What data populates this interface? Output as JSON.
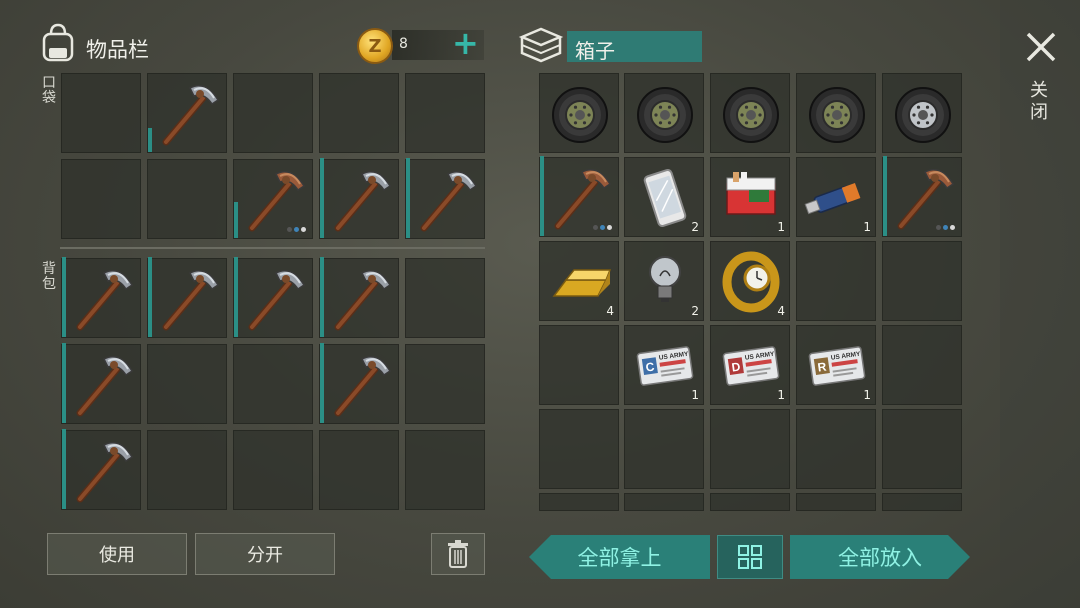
{
  "inventory": {
    "title": "物品栏",
    "pocket_label": "口袋",
    "backpack_label": "背包",
    "coins": "8",
    "coin_symbol": "Z",
    "add_coins_symbol": "+",
    "pocket_slots": [
      {
        "item": "empty"
      },
      {
        "item": "pickaxe",
        "durability": 0.3
      },
      {
        "item": "empty"
      },
      {
        "item": "empty"
      },
      {
        "item": "empty"
      },
      {
        "item": "empty"
      },
      {
        "item": "empty"
      },
      {
        "item": "pickaxe-rusty",
        "durability": 0.45,
        "upgrade_dots": 3
      },
      {
        "item": "pickaxe",
        "durability": 1.0
      },
      {
        "item": "pickaxe",
        "durability": 1.0
      }
    ],
    "backpack_slots": [
      {
        "item": "pickaxe",
        "durability": 1.0
      },
      {
        "item": "pickaxe",
        "durability": 1.0
      },
      {
        "item": "pickaxe",
        "durability": 1.0
      },
      {
        "item": "pickaxe",
        "durability": 1.0
      },
      {
        "item": "empty"
      },
      {
        "item": "pickaxe",
        "durability": 1.0
      },
      {
        "item": "empty"
      },
      {
        "item": "empty"
      },
      {
        "item": "pickaxe",
        "durability": 1.0
      },
      {
        "item": "empty"
      },
      {
        "item": "pickaxe",
        "durability": 1.0
      },
      {
        "item": "empty"
      },
      {
        "item": "empty"
      },
      {
        "item": "empty"
      },
      {
        "item": "empty"
      }
    ]
  },
  "box": {
    "title": "箱子",
    "slots": [
      {
        "item": "tire-military"
      },
      {
        "item": "tire-military"
      },
      {
        "item": "tire-military"
      },
      {
        "item": "tire-military"
      },
      {
        "item": "tire"
      },
      {
        "item": "pickaxe-rusty",
        "durability": 1.0,
        "upgrade_dots": 3
      },
      {
        "item": "smartphone",
        "qty": "2"
      },
      {
        "item": "cigarettes",
        "qty": "1"
      },
      {
        "item": "usb-drive",
        "qty": "1"
      },
      {
        "item": "pickaxe-rusty",
        "durability": 1.0,
        "upgrade_dots": 3
      },
      {
        "item": "gold-bar",
        "qty": "4"
      },
      {
        "item": "light-bulb",
        "qty": "2"
      },
      {
        "item": "gold-watch",
        "qty": "4"
      },
      {
        "item": "empty"
      },
      {
        "item": "empty"
      },
      {
        "item": "empty"
      },
      {
        "item": "keycard",
        "letter": "C",
        "header": "US ARMY",
        "qty": "1",
        "color": "#3f6fa8"
      },
      {
        "item": "keycard",
        "letter": "D",
        "header": "US ARMY",
        "qty": "1",
        "color": "#b03a3a"
      },
      {
        "item": "keycard",
        "letter": "R",
        "header": "US ARMY",
        "qty": "1",
        "color": "#8a6a3a"
      },
      {
        "item": "empty"
      },
      {
        "item": "empty"
      },
      {
        "item": "empty"
      },
      {
        "item": "empty"
      },
      {
        "item": "empty"
      },
      {
        "item": "empty"
      }
    ]
  },
  "close_label": "关闭",
  "buttons": {
    "use": "使用",
    "split": "分开",
    "take_all": "全部拿上",
    "put_all": "全部放入"
  },
  "colors": {
    "accent": "#2a8078",
    "durability_bar": "#2b8f86",
    "slot_bg": "#30322c"
  }
}
